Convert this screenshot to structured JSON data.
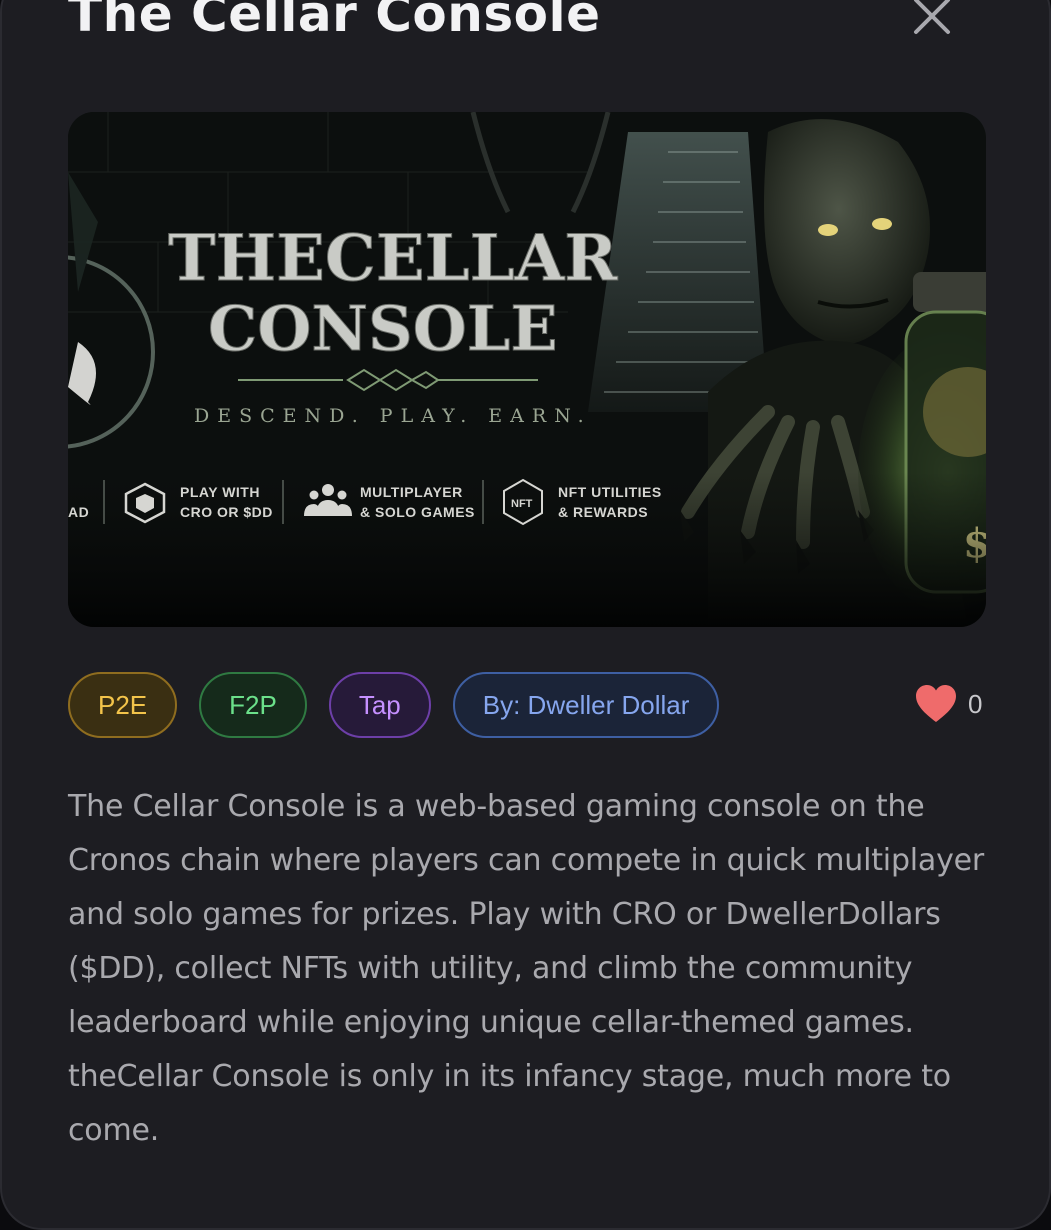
{
  "modal": {
    "title": "The Cellar Console",
    "close_icon": "close-icon"
  },
  "banner": {
    "line1": "THECELLAR",
    "line2": "CONSOLE",
    "tagline": "DESCEND. PLAY. EARN.",
    "partial_left": "AD",
    "features": [
      {
        "icon": "shield-icon",
        "line1": "PLAY WITH",
        "line2": "CRO OR $DD"
      },
      {
        "icon": "users-icon",
        "line1": "MULTIPLAYER",
        "line2": "& SOLO GAMES"
      },
      {
        "icon": "nft-badge-icon",
        "badge": "NFT",
        "line1": "NFT UTILITIES",
        "line2": "& REWARDS"
      }
    ]
  },
  "tags": {
    "p2e": "P2E",
    "f2p": "F2P",
    "tap": "Tap",
    "by": "By: Dweller Dollar"
  },
  "likes": {
    "icon": "heart-icon",
    "count": "0"
  },
  "description": "The Cellar Console is a web-based gaming console on the Cronos chain where players can compete in quick multiplayer and solo games for prizes. Play with CRO or DwellerDollars ($DD), collect NFTs with utility, and climb the community leaderboard while enjoying unique cellar-themed games. theCellar Console is only in its infancy stage, much more to come.",
  "colors": {
    "background": "#1d1d22",
    "p2e": "#f3c44a",
    "f2p": "#6be08a",
    "tap": "#c590ff",
    "by": "#86a6ee",
    "heart": "#ef6b6b"
  }
}
